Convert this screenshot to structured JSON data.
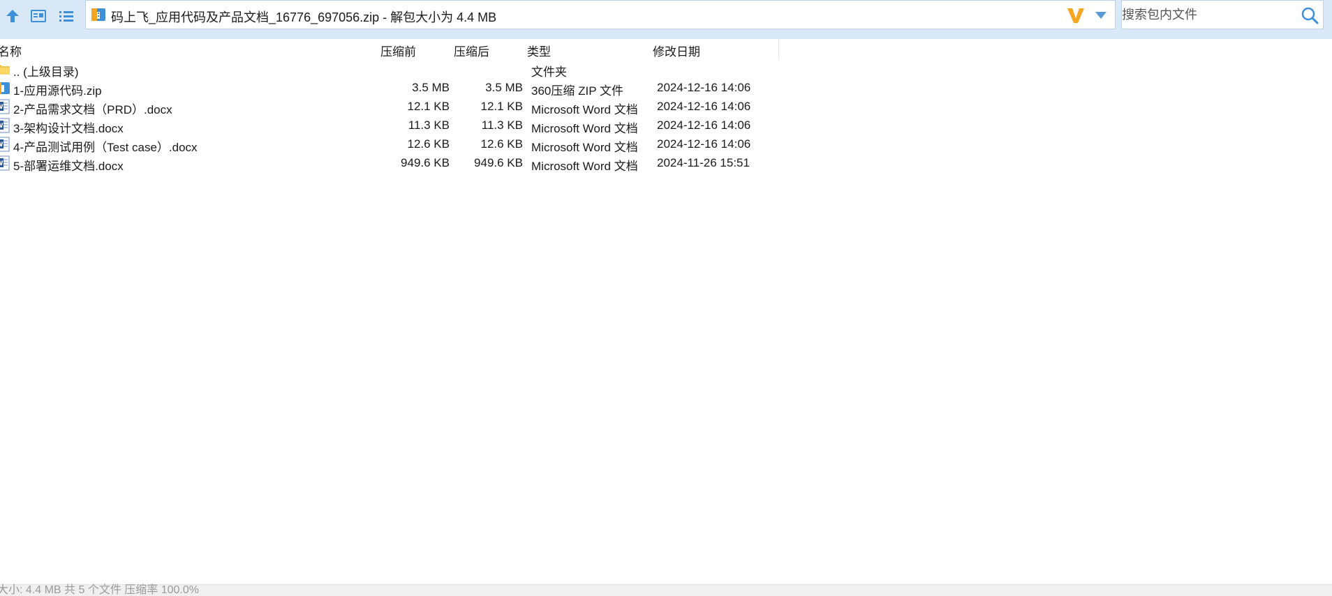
{
  "toolbar": {
    "up_icon": "arrow-up-icon",
    "view_icon": "thumbnail-view-icon",
    "list_icon": "list-view-icon",
    "address": "码上飞_应用代码及产品文档_16776_697056.zip - 解包大小为 4.4 MB",
    "search_placeholder": "搜索包内文件"
  },
  "columns": {
    "name": "名称",
    "before": "压缩前",
    "after": "压缩后",
    "type": "类型",
    "date": "修改日期"
  },
  "rows": [
    {
      "icon": "folder-icon",
      "name": ".. (上级目录)",
      "before": "",
      "after": "",
      "type": "文件夹",
      "date": ""
    },
    {
      "icon": "zip-icon",
      "name": "1-应用源代码.zip",
      "before": "3.5 MB",
      "after": "3.5 MB",
      "type": "360压缩 ZIP 文件",
      "date": "2024-12-16 14:06"
    },
    {
      "icon": "word-icon",
      "name": "2-产品需求文档（PRD）.docx",
      "before": "12.1 KB",
      "after": "12.1 KB",
      "type": "Microsoft Word 文档",
      "date": "2024-12-16 14:06"
    },
    {
      "icon": "word-icon",
      "name": "3-架构设计文档.docx",
      "before": "11.3 KB",
      "after": "11.3 KB",
      "type": "Microsoft Word 文档",
      "date": "2024-12-16 14:06"
    },
    {
      "icon": "word-icon",
      "name": "4-产品测试用例（Test case）.docx",
      "before": "12.6 KB",
      "after": "12.6 KB",
      "type": "Microsoft Word 文档",
      "date": "2024-12-16 14:06"
    },
    {
      "icon": "word-icon",
      "name": "5-部署运维文档.docx",
      "before": "949.6 KB",
      "after": "949.6 KB",
      "type": "Microsoft Word 文档",
      "date": "2024-11-26 15:51"
    }
  ],
  "status": "大小: 4.4 MB 共 5 个文件 压缩率 100.0%",
  "colors": {
    "toolbar_bg": "#d9e8f7",
    "accent_blue": "#3d8fd8",
    "logo_orange": "#f5a623"
  }
}
